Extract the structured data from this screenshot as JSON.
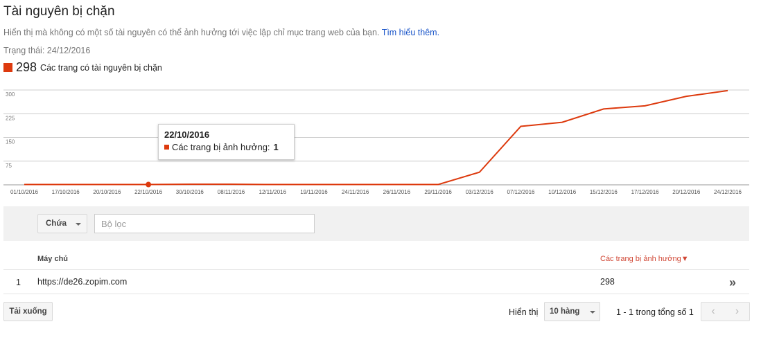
{
  "page": {
    "title": "Tài nguyên bị chặn",
    "description": "Hiển thị mà không có một số tài nguyên có thể ảnh hưởng tới việc lập chỉ mục trang web của bạn.",
    "learn_more": "Tìm hiểu thêm.",
    "status": "Trạng thái: 24/12/2016"
  },
  "legend": {
    "count": "298",
    "label": "Các trang có tài nguyên bị chặn",
    "color": "#dd3a0e"
  },
  "chart_data": {
    "type": "line",
    "ylim": [
      0,
      300
    ],
    "y_ticks": [
      "300",
      "225",
      "150",
      "75"
    ],
    "x_tick_labels": [
      "01/10/2016",
      "17/10/2016",
      "20/10/2016",
      "22/10/2016",
      "30/10/2016",
      "08/11/2016",
      "12/11/2016",
      "19/11/2016",
      "24/11/2016",
      "26/11/2016",
      "29/11/2016",
      "03/12/2016",
      "07/12/2016",
      "10/12/2016",
      "15/12/2016",
      "17/12/2016",
      "20/12/2016",
      "24/12/2016"
    ],
    "series": [
      {
        "name": "Các trang bị ảnh hưởng",
        "color": "#dd3a0e",
        "values": [
          1,
          1,
          1,
          1,
          2,
          2,
          1,
          1,
          1,
          1,
          1,
          40,
          185,
          198,
          240,
          250,
          280,
          298
        ]
      }
    ],
    "highlight_index": 3,
    "grid": true
  },
  "tooltip": {
    "date": "22/10/2016",
    "label": "Các trang bị ảnh hưởng:",
    "value": "1"
  },
  "filter": {
    "select_value": "Chứa",
    "placeholder": "Bộ lọc"
  },
  "table": {
    "columns": {
      "host": "Máy chủ",
      "pages": "Các trang bị ảnh hưởng▼"
    },
    "rows": [
      {
        "index": "1",
        "host": "https://de26.zopim.com",
        "pages": "298",
        "open": "»"
      }
    ]
  },
  "footer": {
    "download": "Tải xuống",
    "show_label": "Hiển thị",
    "rows_value": "10 hàng",
    "pager_text": "1 - 1 trong tổng số 1",
    "prev": "‹",
    "next": "›"
  }
}
